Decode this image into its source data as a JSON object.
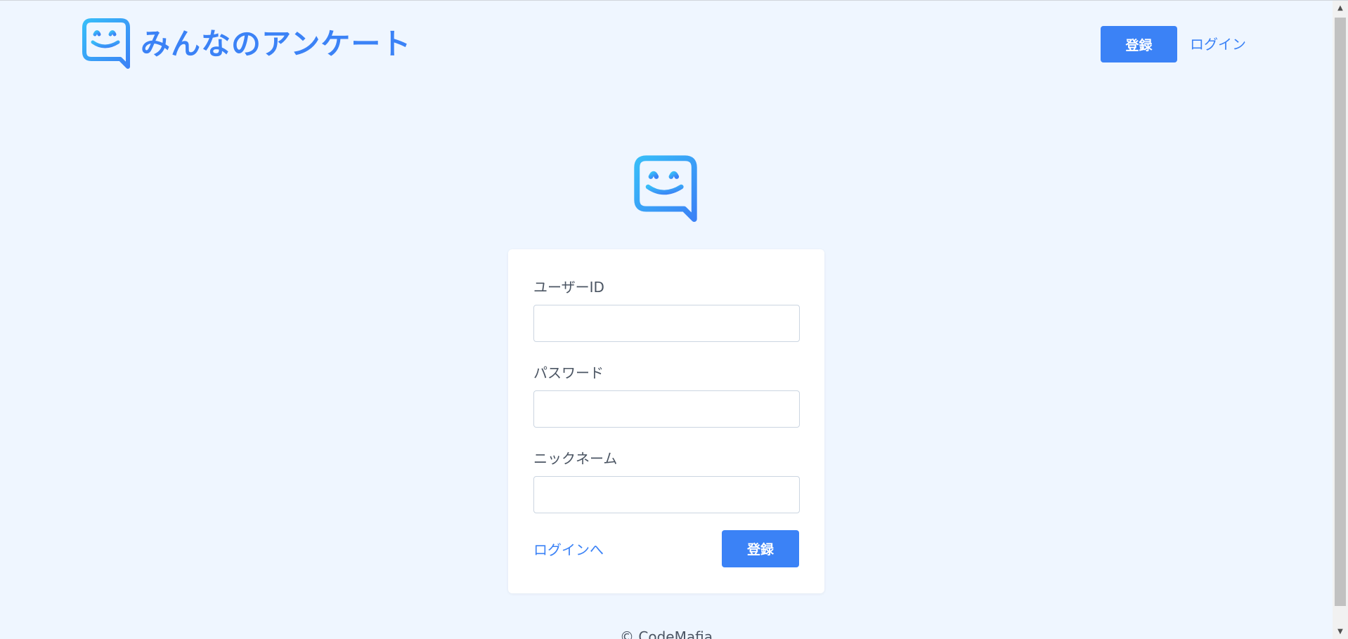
{
  "header": {
    "brand_name": "みんなのアンケート",
    "register_label": "登録",
    "login_label": "ログイン"
  },
  "form": {
    "user_id_label": "ユーザーID",
    "user_id_value": "",
    "password_label": "パスワード",
    "password_value": "",
    "nickname_label": "ニックネーム",
    "nickname_value": "",
    "login_link_label": "ログインへ",
    "register_label": "登録"
  },
  "footer": {
    "copyright": "© CodeMafia"
  },
  "icons": {
    "logo": "smiley-chat-bubble-icon",
    "scroll_up": "triangle-up-icon",
    "scroll_down": "triangle-down-icon"
  },
  "colors": {
    "background": "#eff6ff",
    "accent": "#3b82f6",
    "logo_gradient_start": "#38bdf8",
    "logo_gradient_end": "#3b82f6"
  }
}
